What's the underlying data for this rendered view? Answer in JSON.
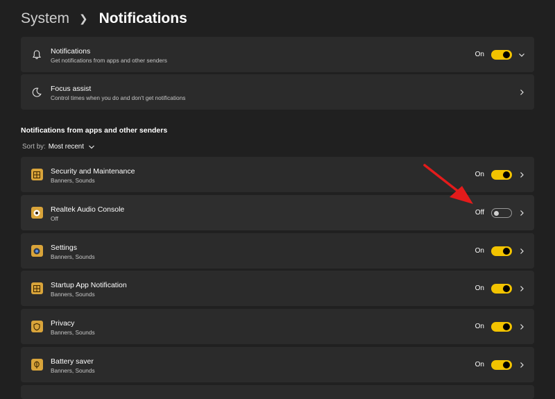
{
  "breadcrumb": {
    "parent": "System",
    "current": "Notifications"
  },
  "top_cards": [
    {
      "title": "Notifications",
      "subtitle": "Get notifications from apps and other senders",
      "state": "On",
      "icon": "bell-icon",
      "chevron": "chevron-down-icon"
    },
    {
      "title": "Focus assist",
      "subtitle": "Control times when you do and don't get notifications",
      "icon": "moon-icon",
      "chevron": "chevron-right-icon"
    }
  ],
  "section": {
    "title": "Notifications from apps and other senders"
  },
  "sort": {
    "label": "Sort by:",
    "value": "Most recent"
  },
  "apps": [
    {
      "name": "Security and Maintenance",
      "subtitle": "Banners, Sounds",
      "state": "On",
      "icon": "security-maintenance-icon"
    },
    {
      "name": "Realtek Audio Console",
      "subtitle": "Off",
      "state": "Off",
      "icon": "realtek-audio-icon"
    },
    {
      "name": "Settings",
      "subtitle": "Banners, Sounds",
      "state": "On",
      "icon": "settings-app-icon"
    },
    {
      "name": "Startup App Notification",
      "subtitle": "Banners, Sounds",
      "state": "On",
      "icon": "startup-app-icon"
    },
    {
      "name": "Privacy",
      "subtitle": "Banners, Sounds",
      "state": "On",
      "icon": "privacy-shield-icon"
    },
    {
      "name": "Battery saver",
      "subtitle": "Banners, Sounds",
      "state": "On",
      "icon": "battery-saver-icon"
    }
  ],
  "colors": {
    "background": "#202020",
    "card": "#2b2b2b",
    "accent": "#f2c300",
    "annotation_arrow": "#e31b1b",
    "app_icon_bg": "#d9a43a"
  }
}
